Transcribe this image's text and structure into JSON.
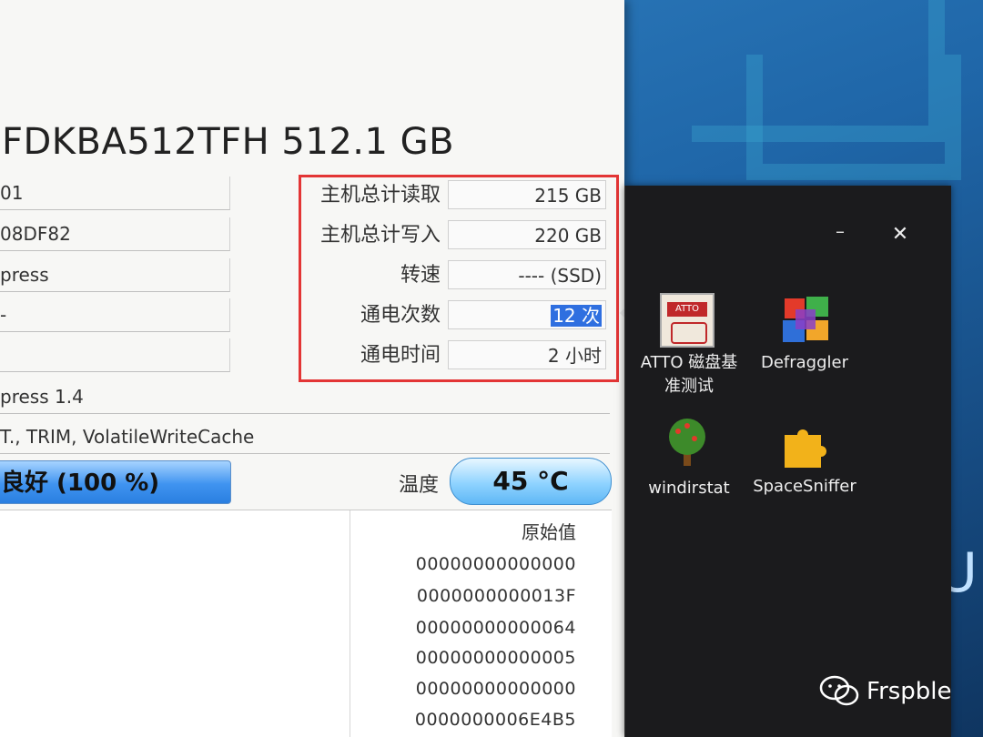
{
  "disk": {
    "title": "FDKBA512TFH 512.1 GB",
    "fields_left": [
      "01",
      "08DF82",
      "press",
      "-",
      ""
    ],
    "interface": "press 1.4",
    "features": "T., TRIM, VolatileWriteCache"
  },
  "stats": {
    "host_reads_label": "主机总计读取",
    "host_reads_value": "215 GB",
    "host_writes_label": "主机总计写入",
    "host_writes_value": "220 GB",
    "rotation_label": "转速",
    "rotation_value": "---- (SSD)",
    "power_count_label": "通电次数",
    "power_count_value": "12 次",
    "power_hours_label": "通电时间",
    "power_hours_value": "2 小时"
  },
  "health": {
    "text": "良好 (100 %)"
  },
  "temperature": {
    "label": "温度",
    "value": "45 °C"
  },
  "smart": {
    "raw_header": "原始值",
    "raw_values": [
      "00000000000000",
      "0000000000013F",
      "00000000000064",
      "00000000000005",
      "00000000000000",
      "0000000006E4B5"
    ]
  },
  "launcher": {
    "minimize": "–",
    "close": "✕",
    "apps": [
      {
        "label_line1": "ATTO 磁盘基",
        "label_line2": "准测试",
        "icon_name": "atto-icon",
        "icon_text": "ATTO"
      },
      {
        "label_line1": "Defraggler",
        "label_line2": "",
        "icon_name": "defraggler-icon"
      },
      {
        "label_line1": "windirstat",
        "label_line2": "",
        "icon_name": "tree-icon"
      },
      {
        "label_line1": "SpaceSniffer",
        "label_line2": "",
        "icon_name": "puzzle-icon"
      }
    ]
  },
  "desktop": {
    "deco_text": "U"
  },
  "watermark": {
    "text": "Frspble"
  },
  "colors": {
    "highlight_red": "#e33535",
    "selection_blue": "#2f6fe0",
    "health_blue": "#3f93f0"
  }
}
